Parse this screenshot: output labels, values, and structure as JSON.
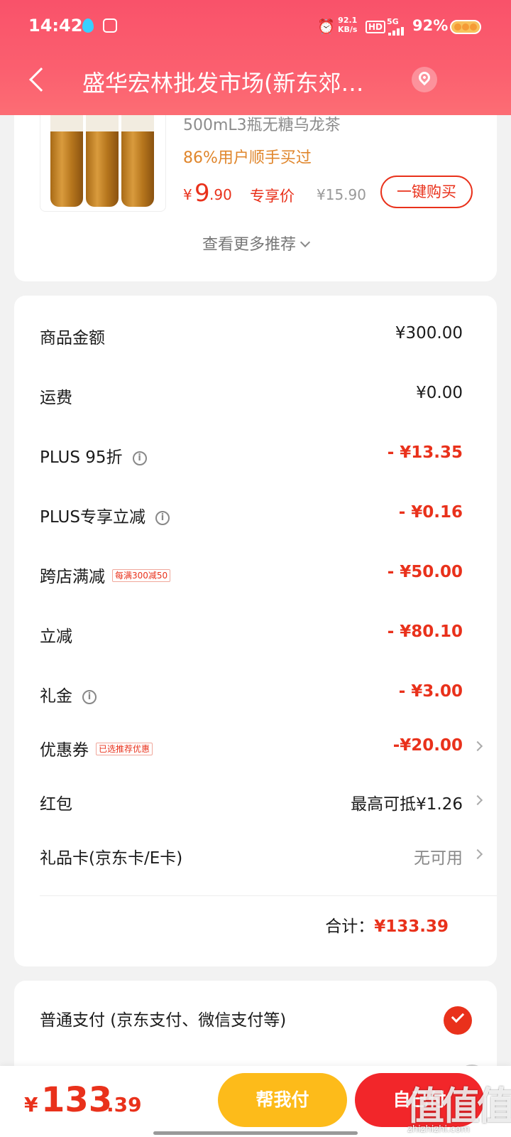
{
  "status_bar": {
    "time": "14:42",
    "net_speed_value": "92.1",
    "net_speed_unit": "KB/s",
    "hd": "HD",
    "network": "5G",
    "battery": "92%"
  },
  "nav": {
    "title": "盛华宏林批发市场(新东郊…"
  },
  "recommendation": {
    "product_name": "500mL3瓶无糖乌龙茶",
    "buy_rate": "86%用户顺手买过",
    "price_currency": "¥",
    "price_integer": "9",
    "price_decimal": ".90",
    "price_tag": "专享价",
    "original_price": "¥15.90",
    "buy_button": "一键购买",
    "more_label": "查看更多推荐"
  },
  "summary": {
    "rows": [
      {
        "label": "商品金额",
        "value": "¥300.00"
      },
      {
        "label": "运费",
        "value": "¥0.00"
      },
      {
        "label": "PLUS 95折",
        "value": "- ¥13.35"
      },
      {
        "label": "PLUS专享立减",
        "value": "- ¥0.16"
      },
      {
        "label": "跨店满减",
        "tag": "每满300减50",
        "value": "- ¥50.00"
      },
      {
        "label": "立减",
        "value": "- ¥80.10"
      },
      {
        "label": "礼金",
        "value": "- ¥3.00"
      },
      {
        "label": "优惠券",
        "tag": "已选推荐优惠",
        "value": "-¥20.00"
      },
      {
        "label": "红包",
        "value": "最高可抵¥1.26"
      },
      {
        "label": "礼品卡(京东卡/E卡)",
        "value": "无可用"
      }
    ],
    "total_label": "合计：",
    "total_value": "¥133.39"
  },
  "payment": {
    "option_normal": "普通支付 (京东支付、微信支付等)"
  },
  "bottom_bar": {
    "currency": "¥",
    "amount_integer": "133",
    "amount_decimal": ".39",
    "help_pay_button": "帮我付",
    "self_pay_button": "自己付"
  },
  "watermark": {
    "logo_text": "值值值",
    "site": "zhizhizhi.com"
  },
  "colors": {
    "accent_red": "#e9311b",
    "header_pink": "#f9526a",
    "help_yellow": "#fdbb1a"
  },
  "icons": [
    "back-arrow-icon",
    "location-pin-icon",
    "info-icon",
    "chevron-right-icon",
    "check-circle-icon",
    "chevron-down-icon"
  ]
}
